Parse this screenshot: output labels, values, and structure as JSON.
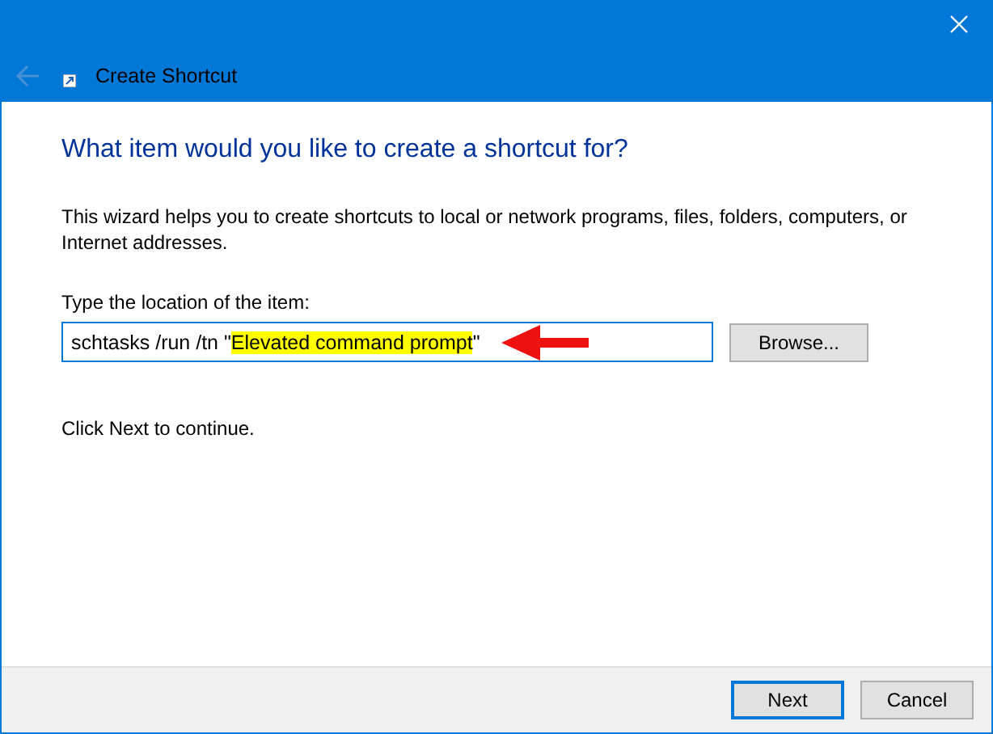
{
  "window": {
    "title": "Create Shortcut",
    "back_disabled": true
  },
  "heading": "What item would you like to create a shortcut for?",
  "description": "This wizard helps you to create shortcuts to local or network programs, files, folders, computers, or Internet addresses.",
  "location": {
    "label": "Type the location of the item:",
    "value_parts": [
      {
        "text": "schtasks /run /tn \"",
        "highlighted": false
      },
      {
        "text": "Elevated command prompt",
        "highlighted": true
      },
      {
        "text": "\"",
        "highlighted": false
      }
    ],
    "annotation_arrow": true,
    "browse": "Browse..."
  },
  "hint": "Click Next to continue.",
  "buttons": [
    {
      "label": "Next",
      "selected": true
    },
    {
      "label": "Cancel",
      "selected": false
    }
  ]
}
